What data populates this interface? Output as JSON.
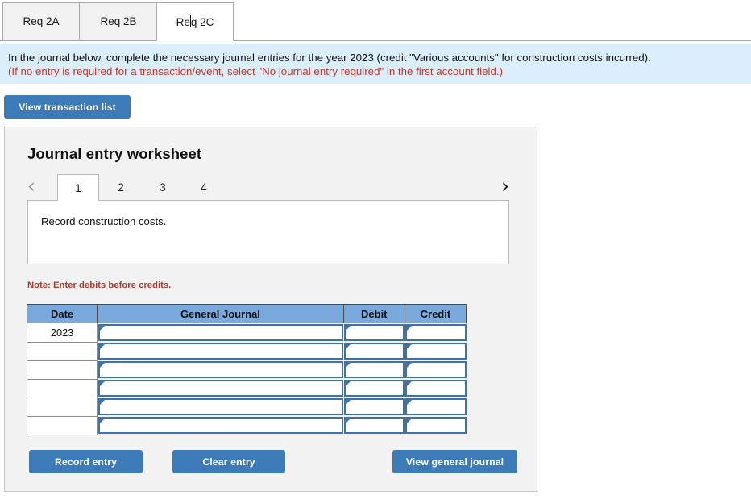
{
  "tabs": [
    {
      "label": "Req 2A",
      "active": false
    },
    {
      "label": "Req 2B",
      "active": false
    },
    {
      "label": "Req 2C",
      "active": true
    }
  ],
  "instructions": {
    "line1": "In the journal below, complete the necessary journal entries for the year 2023 (credit \"Various accounts\" for construction costs incurred).",
    "line2": "(If no entry is required for a transaction/event, select \"No journal entry required\" in the first account field.)"
  },
  "toolbar": {
    "view_transaction_list_label": "View transaction list"
  },
  "worksheet": {
    "title": "Journal entry worksheet",
    "prev_chevron": "‹",
    "next_chevron": "›",
    "pages": [
      {
        "label": "1",
        "active": true
      },
      {
        "label": "2",
        "active": false
      },
      {
        "label": "3",
        "active": false
      },
      {
        "label": "4",
        "active": false
      }
    ],
    "description": "Record construction costs.",
    "note": "Note: Enter debits before credits."
  },
  "table": {
    "headers": [
      "Date",
      "General Journal",
      "Debit",
      "Credit"
    ],
    "rows": [
      {
        "date": "2023",
        "journal": "",
        "debit": "",
        "credit": ""
      },
      {
        "date": "",
        "journal": "",
        "debit": "",
        "credit": ""
      },
      {
        "date": "",
        "journal": "",
        "debit": "",
        "credit": ""
      },
      {
        "date": "",
        "journal": "",
        "debit": "",
        "credit": ""
      },
      {
        "date": "",
        "journal": "",
        "debit": "",
        "credit": ""
      },
      {
        "date": "",
        "journal": "",
        "debit": "",
        "credit": ""
      }
    ]
  },
  "footer": {
    "record_entry_label": "Record entry",
    "clear_entry_label": "Clear entry",
    "view_general_journal_label": "View general journal"
  },
  "colors": {
    "accent_blue": "#3c7ab8",
    "header_blue": "#7aa9dd",
    "banner_blue": "#dbeefb",
    "field_border": "#3d72ab",
    "note_red": "#b03a2e",
    "instruction_red": "#c0392b",
    "panel_gray": "#f2f2f2"
  }
}
